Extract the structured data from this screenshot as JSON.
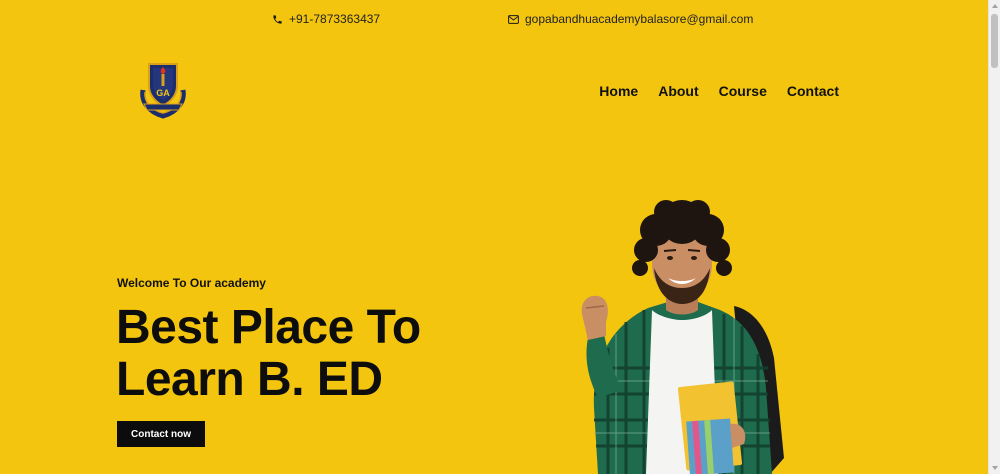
{
  "topbar": {
    "phone": "+91-7873363437",
    "email": "gopabandhuacademybalasore@gmail.com"
  },
  "logo": {
    "monogram": "GA"
  },
  "nav": {
    "items": [
      {
        "label": "Home"
      },
      {
        "label": "About"
      },
      {
        "label": "Course"
      },
      {
        "label": "Contact"
      }
    ]
  },
  "hero": {
    "eyebrow": "Welcome To Our academy",
    "title_line1": "Best Place To",
    "title_line2": "Learn B. ED",
    "cta_label": "Contact now"
  },
  "icons": {
    "phone": "phone-icon",
    "email": "envelope-icon"
  },
  "colors": {
    "background": "#f3c50f",
    "text": "#0d0d0d",
    "button_bg": "#0c0c0c",
    "button_text": "#ffffff"
  }
}
